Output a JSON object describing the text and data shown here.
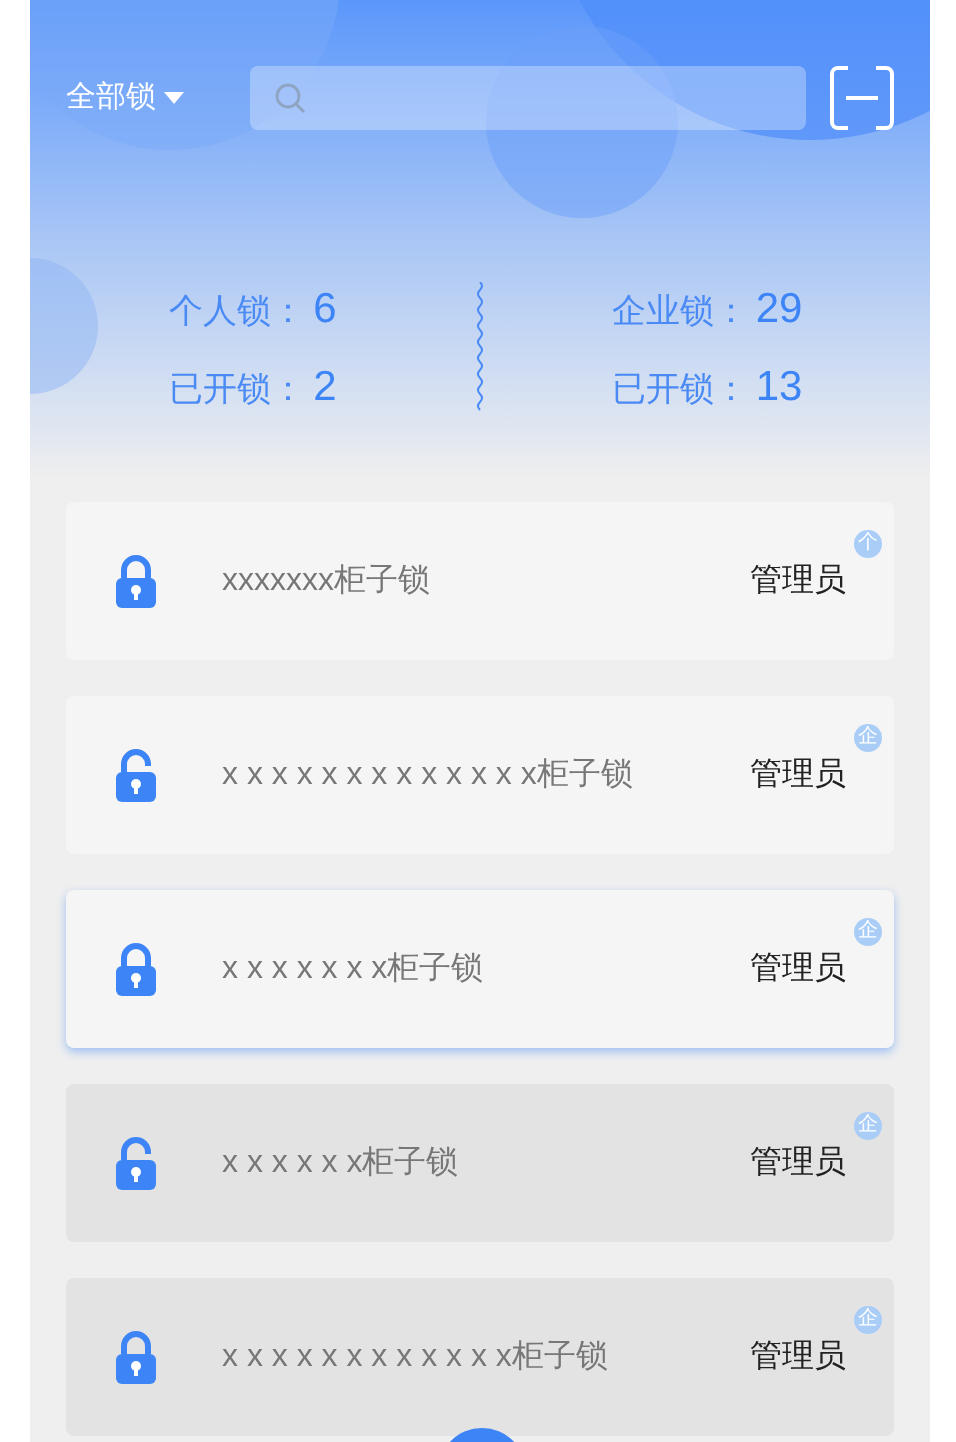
{
  "header": {
    "filter": "全部锁"
  },
  "stats": {
    "left": [
      {
        "label": "个人锁：",
        "value": "6"
      },
      {
        "label": "已开锁：",
        "value": "2"
      }
    ],
    "right": [
      {
        "label": "企业锁：",
        "value": "29"
      },
      {
        "label": "已开锁：",
        "value": "13"
      }
    ]
  },
  "locks": [
    {
      "name": "xxxxxxx柜子锁",
      "role": "管理员",
      "badge": "个",
      "locked": true,
      "selected": false,
      "dimmed": false
    },
    {
      "name": "x x x x x x x x x x x x x柜子锁",
      "role": "管理员",
      "badge": "企",
      "locked": false,
      "selected": false,
      "dimmed": false
    },
    {
      "name": "x x x x x x x柜子锁",
      "role": "管理员",
      "badge": "企",
      "locked": true,
      "selected": true,
      "dimmed": false
    },
    {
      "name": "x x x x x x柜子锁",
      "role": "管理员",
      "badge": "企",
      "locked": false,
      "selected": false,
      "dimmed": true
    },
    {
      "name": "x x x x x x x x x x x x柜子锁",
      "role": "管理员",
      "badge": "企",
      "locked": true,
      "selected": false,
      "dimmed": true
    }
  ]
}
